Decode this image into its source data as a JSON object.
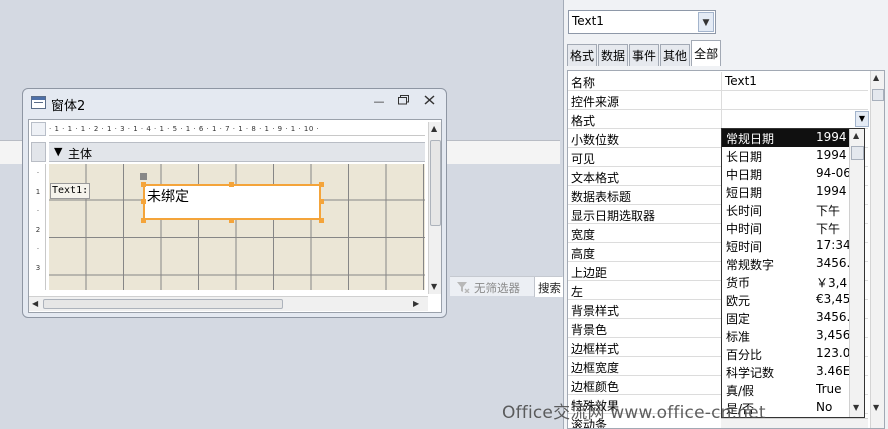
{
  "status_bar": {
    "filter_label": "无筛选器",
    "search_label": "搜索"
  },
  "form_window": {
    "title": "窗体2",
    "ruler_text": "· 1 · 1 · 1 · 2 · 1 · 3 · 1 · 4 · 1 · 5 · 1 · 6 · 1 · 7 · 1 · 8 · 1 · 9 · 1 · 10 ·",
    "vruler_marks": [
      "·",
      "1",
      "·",
      "2",
      "·",
      "3"
    ],
    "section_label": "主体",
    "label_control": "Text1:",
    "textbox_value": "未绑定"
  },
  "property_sheet": {
    "selected_object": "Text1",
    "tabs": [
      "格式",
      "数据",
      "事件",
      "其他",
      "全部"
    ],
    "active_tab": "全部",
    "rows": [
      {
        "name": "名称",
        "value": "Text1"
      },
      {
        "name": "控件来源",
        "value": ""
      },
      {
        "name": "格式",
        "value": ""
      },
      {
        "name": "小数位数",
        "value": ""
      },
      {
        "name": "可见",
        "value": ""
      },
      {
        "name": "文本格式",
        "value": ""
      },
      {
        "name": "数据表标题",
        "value": ""
      },
      {
        "name": "显示日期选取器",
        "value": ""
      },
      {
        "name": "宽度",
        "value": ""
      },
      {
        "name": "高度",
        "value": ""
      },
      {
        "name": "上边距",
        "value": ""
      },
      {
        "name": "左",
        "value": ""
      },
      {
        "name": "背景样式",
        "value": ""
      },
      {
        "name": "背景色",
        "value": ""
      },
      {
        "name": "边框样式",
        "value": ""
      },
      {
        "name": "边框宽度",
        "value": ""
      },
      {
        "name": "边框颜色",
        "value": ""
      },
      {
        "name": "特殊效果",
        "value": ""
      },
      {
        "name": "滚动条",
        "value": ""
      }
    ]
  },
  "format_dropdown": {
    "selected": "常规日期",
    "options": [
      {
        "label": "常规日期",
        "example": "1994"
      },
      {
        "label": "长日期",
        "example": "1994"
      },
      {
        "label": "中日期",
        "example": "94-06"
      },
      {
        "label": "短日期",
        "example": "1994"
      },
      {
        "label": "长时间",
        "example": "下午"
      },
      {
        "label": "中时间",
        "example": "下午"
      },
      {
        "label": "短时间",
        "example": "17:34"
      },
      {
        "label": "常规数字",
        "example": "3456."
      },
      {
        "label": "货币",
        "example": "￥3,4"
      },
      {
        "label": "欧元",
        "example": "€3,45"
      },
      {
        "label": "固定",
        "example": "3456."
      },
      {
        "label": "标准",
        "example": "3,456"
      },
      {
        "label": "百分比",
        "example": "123.0"
      },
      {
        "label": "科学记数",
        "example": "3.46E"
      },
      {
        "label": "真/假",
        "example": "True"
      },
      {
        "label": "是/否",
        "example": "No"
      }
    ]
  },
  "watermark": "Office交流网 www.office-cn.net",
  "colors": {
    "selection_border": "#f4a43a",
    "grid_bg": "#ebe6d6",
    "selected_item_bg": "#101010"
  }
}
